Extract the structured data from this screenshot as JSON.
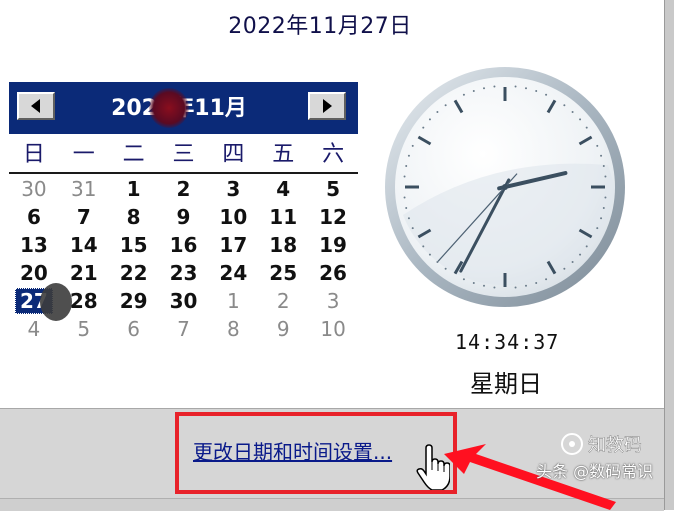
{
  "date_title": "2022年11月27日",
  "calendar": {
    "month_label": "2022年11月",
    "prev_icon": "left-triangle-icon",
    "next_icon": "right-triangle-icon",
    "weekdays": [
      "日",
      "一",
      "二",
      "三",
      "四",
      "五",
      "六"
    ],
    "days": [
      {
        "d": "30",
        "other": true
      },
      {
        "d": "31",
        "other": true
      },
      {
        "d": "1"
      },
      {
        "d": "2"
      },
      {
        "d": "3"
      },
      {
        "d": "4"
      },
      {
        "d": "5"
      },
      {
        "d": "6"
      },
      {
        "d": "7"
      },
      {
        "d": "8"
      },
      {
        "d": "9"
      },
      {
        "d": "10"
      },
      {
        "d": "11"
      },
      {
        "d": "12"
      },
      {
        "d": "13"
      },
      {
        "d": "14"
      },
      {
        "d": "15"
      },
      {
        "d": "16"
      },
      {
        "d": "17"
      },
      {
        "d": "18"
      },
      {
        "d": "19"
      },
      {
        "d": "20"
      },
      {
        "d": "21"
      },
      {
        "d": "22"
      },
      {
        "d": "23"
      },
      {
        "d": "24"
      },
      {
        "d": "25"
      },
      {
        "d": "26"
      },
      {
        "d": "27",
        "selected": true
      },
      {
        "d": "28"
      },
      {
        "d": "29"
      },
      {
        "d": "30"
      },
      {
        "d": "1",
        "other": true
      },
      {
        "d": "2",
        "other": true
      },
      {
        "d": "3",
        "other": true
      },
      {
        "d": "4",
        "other": true
      },
      {
        "d": "5",
        "other": true
      },
      {
        "d": "6",
        "other": true
      },
      {
        "d": "7",
        "other": true
      },
      {
        "d": "8",
        "other": true
      },
      {
        "d": "9",
        "other": true
      },
      {
        "d": "10",
        "other": true
      }
    ]
  },
  "clock": {
    "hours": 14,
    "minutes": 34,
    "seconds": 37,
    "digital_time": "14:34:37",
    "weekday_label": "星期日"
  },
  "footer": {
    "change_link": "更改日期和时间设置..."
  },
  "watermark": {
    "text": "头条 @数码常识",
    "brand": "知教码"
  },
  "colors": {
    "header_bg": "#0b2a78",
    "highlight_border": "#e8222a",
    "link": "#0a1a8a"
  }
}
